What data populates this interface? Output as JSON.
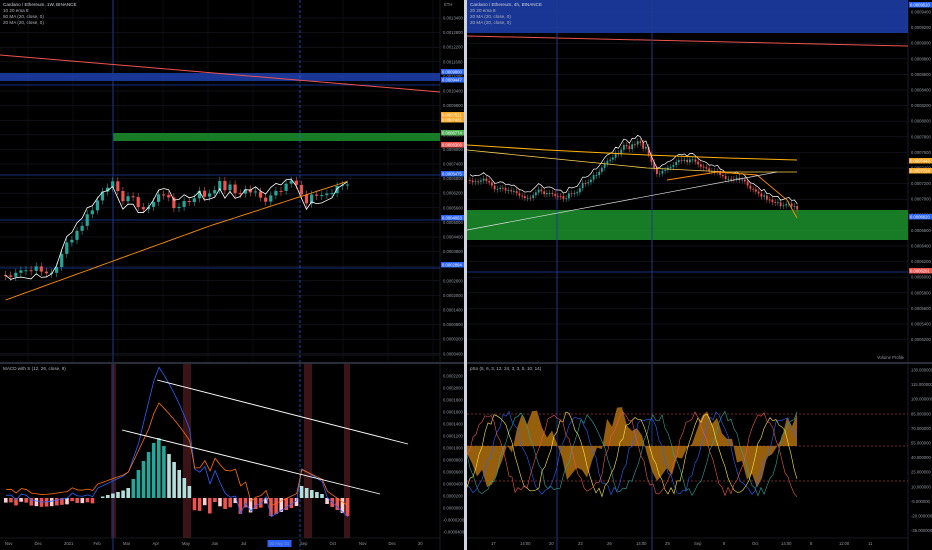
{
  "left_chart": {
    "title": "Cardano / Ethereum, 1W, BINANCE",
    "legend": [
      "10 20 ema 8",
      "50 MA (20, close, 0)",
      "20 MA (20, close, 0)"
    ],
    "price_axis": [
      "0.0013400",
      "0.0012800",
      "0.0012200",
      "0.0011600",
      "0.0011000",
      "0.0010400",
      "0.0009800",
      "0.0009200",
      "0.0008600",
      "0.0008000",
      "0.0007400",
      "0.0006800",
      "0.0006200",
      "0.0005600",
      "0.0005000",
      "0.0004400",
      "0.0003800",
      "0.0003200",
      "0.0002600",
      "0.0002000",
      "0.0001400",
      "0.0000800",
      "0.0000200",
      "0.0000400"
    ],
    "price_tags": [
      {
        "text": "0.0009800",
        "color": "#2962ff"
      },
      {
        "text": "0.0009447",
        "color": "#2962ff"
      },
      {
        "text": "0.0007621",
        "color": "#f9a825"
      },
      {
        "text": "0.0007401",
        "color": "#f9a825"
      },
      {
        "text": "0.0006774",
        "color": "#4caf50"
      },
      {
        "text": "0.0006300",
        "color": "#ef5350"
      },
      {
        "text": "0.0005475",
        "color": "#2962ff"
      },
      {
        "text": "0.0004053",
        "color": "#2962ff"
      },
      {
        "text": "0.0002894",
        "color": "#2962ff"
      }
    ],
    "time_axis": [
      "Nov",
      "Dec",
      "2021",
      "Feb",
      "Mar",
      "Apr",
      "May",
      "Jun",
      "Jul",
      "Aug",
      "Sep",
      "Oct",
      "Nov",
      "Dec",
      "20"
    ],
    "highlight_date": "02 Aug '21",
    "currency": "ETH"
  },
  "macd": {
    "title": "MACD with S (12, 26, close, 9)",
    "axis": [
      "0.0002200",
      "0.0002000",
      "0.0001800",
      "0.0001600",
      "0.0001400",
      "0.0001200",
      "0.0001000",
      "0.0000800",
      "0.0000600",
      "0.0000400",
      "0.0000200",
      "0.0000000",
      "-0.0000200",
      "-0.0000400"
    ]
  },
  "right_chart": {
    "title": "Cardano / Ethereum, 4h, BINANCE",
    "legend": [
      "20 20 ema 8",
      "20 MA (20, close, 0)",
      "20 MA (20, close, 0)"
    ],
    "currency": "ETH",
    "price_axis": [
      "0.0009400",
      "0.0009200",
      "0.0009000",
      "0.0008800",
      "0.0008600",
      "0.0008400",
      "0.0008200",
      "0.0008000",
      "0.0007800",
      "0.0007600",
      "0.0007400",
      "0.0007200",
      "0.0007000",
      "0.0006800",
      "0.0006600",
      "0.0006400",
      "0.0006200",
      "0.0006000",
      "0.0005800",
      "0.0005600",
      "0.0005400",
      "0.0005200"
    ],
    "price_tags": [
      {
        "text": "0.0009520",
        "color": "#2962ff"
      },
      {
        "text": "0.0007443",
        "color": "#f9a825"
      },
      {
        "text": "0.0007234",
        "color": "#f9a825"
      },
      {
        "text": "0.0006620",
        "color": "#2962ff"
      },
      {
        "text": "0.0006291",
        "color": "#ef5350"
      }
    ],
    "time_axis": [
      "17",
      "14:00",
      "20",
      "23",
      "26",
      "14:00",
      "29",
      "Sep",
      "8",
      "Oct",
      "14:00",
      "8",
      "11:00",
      "11"
    ],
    "footer_note": "Volume Profile"
  },
  "stoch": {
    "title": "pSo (5, 6, 3, 12, 24, 3, 3, 5, 10, 14)",
    "axis": [
      "130.000000",
      "115.000000",
      "100.000000",
      "85.000000",
      "70.000000",
      "55.000000",
      "40.000000",
      "25.000000",
      "10.000000",
      "-5.000000",
      "-20.000000",
      "-35.000000"
    ]
  },
  "colors": {
    "up": "#26a69a",
    "down": "#ef5350",
    "bg": "#000000",
    "grid": "#1e222d",
    "zone_green": "#1b5e20",
    "zone_blue": "#1e40af"
  }
}
